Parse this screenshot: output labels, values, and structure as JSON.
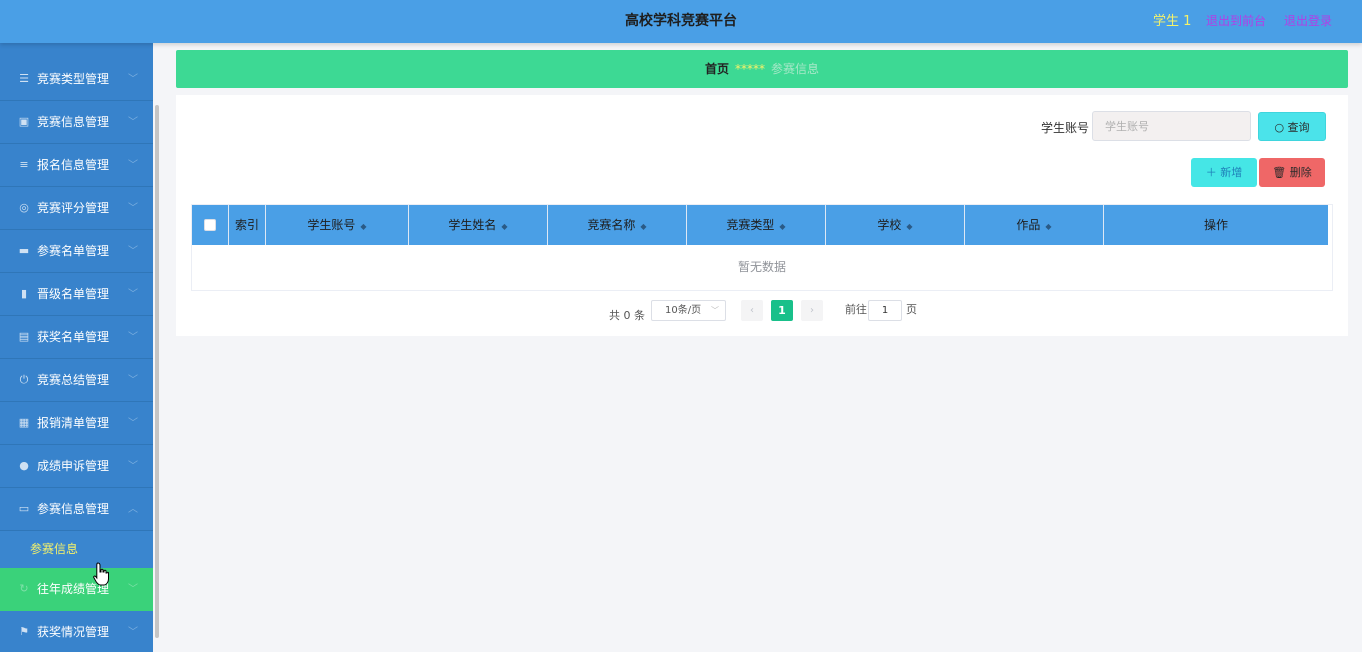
{
  "header": {
    "title": "高校学科竞赛平台",
    "user": "学生 1",
    "link_front": "退出到前台",
    "link_logout": "退出登录"
  },
  "sidebar": {
    "items": [
      {
        "label": "竞赛类型管理",
        "icon": "list-icon"
      },
      {
        "label": "竞赛信息管理",
        "icon": "clipboard-icon"
      },
      {
        "label": "报名信息管理",
        "icon": "sliders-icon"
      },
      {
        "label": "竞赛评分管理",
        "icon": "compass-icon"
      },
      {
        "label": "参赛名单管理",
        "icon": "briefcase-icon"
      },
      {
        "label": "晋级名单管理",
        "icon": "bar-chart-icon"
      },
      {
        "label": "获奖名单管理",
        "icon": "printer-icon"
      },
      {
        "label": "竞赛总结管理",
        "icon": "power-icon"
      },
      {
        "label": "报销清单管理",
        "icon": "grid-icon"
      },
      {
        "label": "成绩申诉管理",
        "icon": "pin-icon"
      },
      {
        "label": "参赛信息管理",
        "icon": "picture-icon"
      },
      {
        "label": "往年成绩管理",
        "icon": "refresh-icon"
      },
      {
        "label": "获奖情况管理",
        "icon": "flag-icon"
      }
    ],
    "submenu": "参赛信息"
  },
  "breadcrumb": {
    "home": "首页",
    "separator": "*****",
    "current": "参赛信息"
  },
  "search": {
    "label": "学生账号",
    "placeholder": "学生账号",
    "button": "查询"
  },
  "actions": {
    "add": "新增",
    "delete": "删除"
  },
  "table": {
    "columns": [
      "索引",
      "学生账号",
      "学生姓名",
      "竞赛名称",
      "竞赛类型",
      "学校",
      "作品",
      "操作"
    ],
    "empty_text": "暂无数据"
  },
  "pagination": {
    "total": "共 0 条",
    "page_size": "10条/页",
    "current_page": "1",
    "goto_label": "前往",
    "goto_value": "1",
    "page_suffix": "页"
  },
  "colors": {
    "header": "#4a9fe6",
    "sidebar": "#3883cc",
    "sidebar_active": "#3ad27a",
    "breadcrumb": "#3dd994",
    "accent_yellow": "#f5f26a",
    "pager_active": "#19c08a",
    "delete": "#ef6767",
    "add": "#45e6e6"
  }
}
